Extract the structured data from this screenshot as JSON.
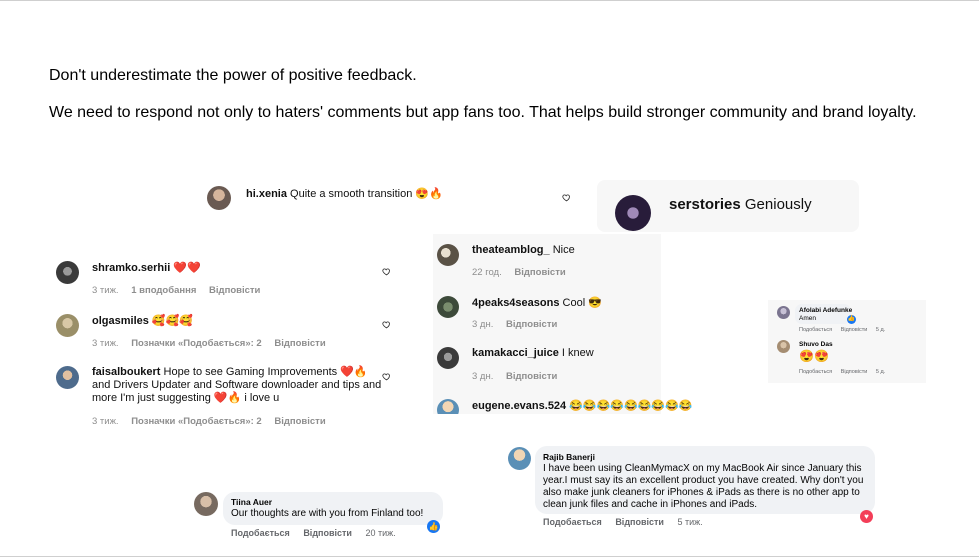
{
  "intro": {
    "line1": "Don't underestimate the power of positive feedback.",
    "line2": "We need to respond not only to haters' comments but app fans too. That helps build stronger community and brand loyalty."
  },
  "xenia": {
    "user": "hi.xenia",
    "text": "Quite a smooth transition 😍🔥"
  },
  "serstories": {
    "user": "serstories",
    "text": "Geniously"
  },
  "left_comments": [
    {
      "user": "shramko.serhii",
      "text": "❤️❤️",
      "meta": [
        "3 тиж.",
        "1 вподобання",
        "Відповісти"
      ]
    },
    {
      "user": "olgasmiles",
      "text": "🥰🥰🥰",
      "meta": [
        "3 тиж.",
        "Позначки «Подобається»: 2",
        "Відповісти"
      ]
    },
    {
      "user": "faisalboukert",
      "text": "Hope to see Gaming Improvements ❤️🔥 and Drivers Updater and Software downloader and tips and more I'm just suggesting ❤️🔥 i love u",
      "meta": [
        "3 тиж.",
        "Позначки «Подобається»: 2",
        "Відповісти"
      ]
    }
  ],
  "mid_comments": [
    {
      "user": "theateamblog_",
      "text": "Nice",
      "meta": [
        "22 год.",
        "Відповісти"
      ]
    },
    {
      "user": "4peaks4seasons",
      "text": "Cool 😎",
      "meta": [
        "3 дн.",
        "Відповісти"
      ]
    },
    {
      "user": "kamakacci_juice",
      "text": "I knew",
      "meta": [
        "3 дн.",
        "Відповісти"
      ]
    },
    {
      "user": "eugene.evans.524",
      "text": "😂😂😂😂😂😂😂😂😂"
    }
  ],
  "small_fb": [
    {
      "name": "Afolabi Adefunke",
      "text": "Amen",
      "meta": [
        "Подобається",
        "Відповісти",
        "5 д."
      ]
    },
    {
      "name": "Shuvo Das",
      "text": "😍😍",
      "meta": [
        "Подобається",
        "Відповісти",
        "5 д."
      ]
    }
  ],
  "rajib": {
    "name": "Rajib Banerji",
    "text": "I have been using CleanMymacX on my MacBook Air since January this year.I must say its an excellent product you have created. Why don't you also make junk cleaners for iPhones & iPads as there is no other app to clean junk files and cache in iPhones and iPads.",
    "meta": [
      "Подобається",
      "Відповісти",
      "5 тиж."
    ]
  },
  "tiina": {
    "name": "Tiina Auer",
    "text": "Our thoughts are with you from Finland too!",
    "meta": [
      "Подобається",
      "Відповісти",
      "20 тиж."
    ]
  },
  "icons": {
    "heart": "heart-outline-icon",
    "like": "thumbs-up-icon",
    "love": "heart-filled-icon"
  },
  "colors": {
    "fb_blue": "#1877f2",
    "fb_love": "#f33e58",
    "meta_gray": "#8e8e8e"
  }
}
